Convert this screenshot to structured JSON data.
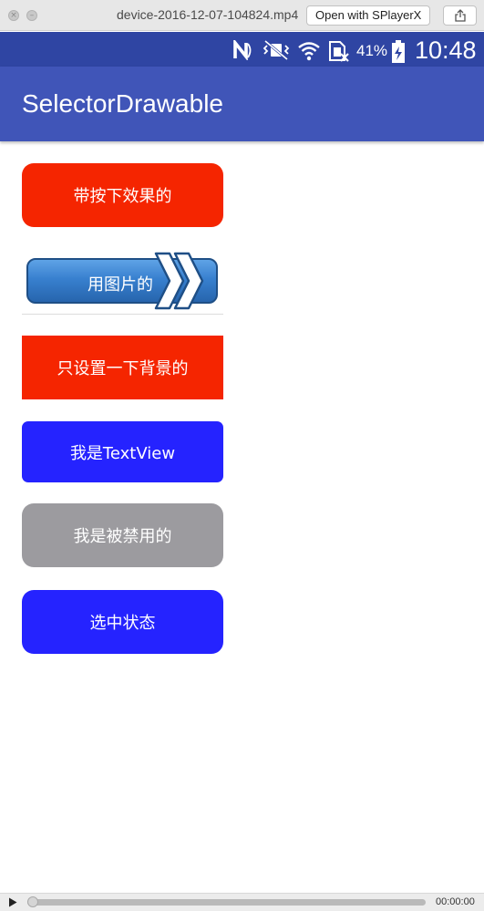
{
  "window": {
    "title": "device-2016-12-07-104824.mp4",
    "open_with_label": "Open with SPlayerX"
  },
  "status_bar": {
    "battery_percent": "41%",
    "time": "10:48",
    "icons": [
      "nfc-icon",
      "vibrate-icon",
      "wifi-icon",
      "no-sim-icon",
      "battery-charging-icon"
    ]
  },
  "app_bar": {
    "title": "SelectorDrawable",
    "color": "#4055b8",
    "status_color": "#2f45a3"
  },
  "buttons": [
    {
      "label": "带按下效果的",
      "style": "rounded",
      "color": "#f52500"
    },
    {
      "label": "用图片的",
      "style": "image",
      "color": "#3880cf"
    },
    {
      "label": "只设置一下背景的",
      "style": "rect",
      "color": "#f52500"
    },
    {
      "label": "我是TextView",
      "style": "rounded",
      "color": "#2523ff"
    },
    {
      "label": "我是被禁用的",
      "style": "disabled",
      "color": "#9c9b9f"
    },
    {
      "label": "选中状态",
      "style": "rounded",
      "color": "#2523ff"
    }
  ],
  "player": {
    "time": "00:00:00",
    "progress": 0
  }
}
